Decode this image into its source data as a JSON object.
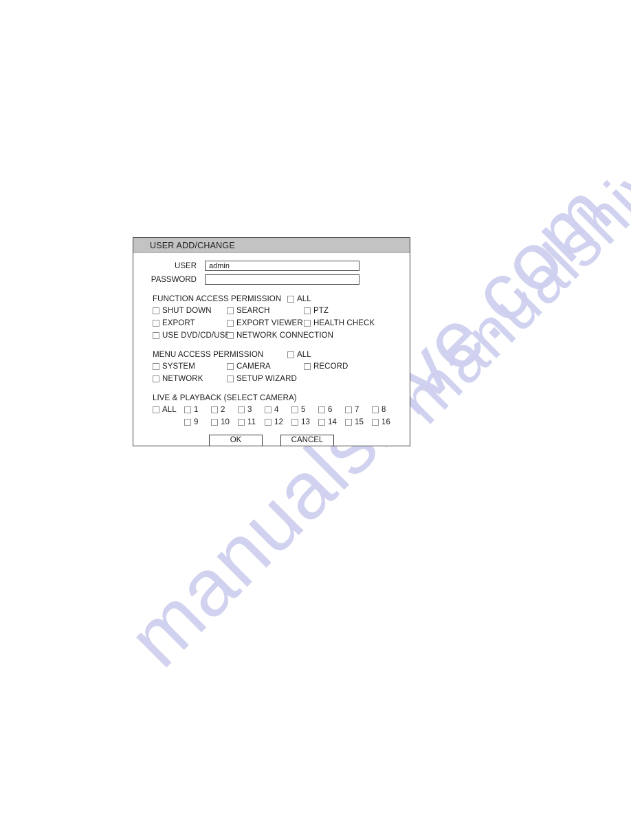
{
  "watermark": {
    "text_primary": "manualshive.com",
    "text_secondary": "manualshive.com",
    "color": "#cfd0ef"
  },
  "dialog": {
    "title": "USER ADD/CHANGE",
    "title_bar_color": "#c3c3c3",
    "border_color": "#3a3a3a",
    "credentials": {
      "user": {
        "label": "USER",
        "value": "admin",
        "placeholder": ""
      },
      "password": {
        "label": "PASSWORD",
        "value": "",
        "placeholder": ""
      }
    },
    "function_access": {
      "heading": "FUNCTION ACCESS PERMISSION",
      "all_label": "ALL",
      "all_checked": false,
      "rows": [
        [
          {
            "label": "SHUT DOWN",
            "checked": false
          },
          {
            "label": "SEARCH",
            "checked": false
          },
          {
            "label": "PTZ",
            "checked": false
          }
        ],
        [
          {
            "label": "EXPORT",
            "checked": false
          },
          {
            "label": "EXPORT VIEWER",
            "checked": false
          },
          {
            "label": "HEALTH CHECK",
            "checked": false
          }
        ],
        [
          {
            "label": "USE DVD/CD/USB",
            "checked": false
          },
          {
            "label": "NETWORK CONNECTION",
            "checked": false
          }
        ]
      ]
    },
    "menu_access": {
      "heading": "MENU ACCESS PERMISSION",
      "all_label": "ALL",
      "all_checked": false,
      "rows": [
        [
          {
            "label": "SYSTEM",
            "checked": false
          },
          {
            "label": "CAMERA",
            "checked": false
          },
          {
            "label": "RECORD",
            "checked": false
          }
        ],
        [
          {
            "label": "NETWORK",
            "checked": false
          },
          {
            "label": "SETUP WIZARD",
            "checked": false
          }
        ]
      ]
    },
    "live_playback": {
      "heading": "LIVE & PLAYBACK (SELECT CAMERA)",
      "all_label": "ALL",
      "all_checked": false,
      "row1": [
        "1",
        "2",
        "3",
        "4",
        "5",
        "6",
        "7",
        "8"
      ],
      "row2": [
        "9",
        "10",
        "11",
        "12",
        "13",
        "14",
        "15",
        "16"
      ]
    },
    "buttons": {
      "ok": "OK",
      "cancel": "CANCEL"
    }
  }
}
